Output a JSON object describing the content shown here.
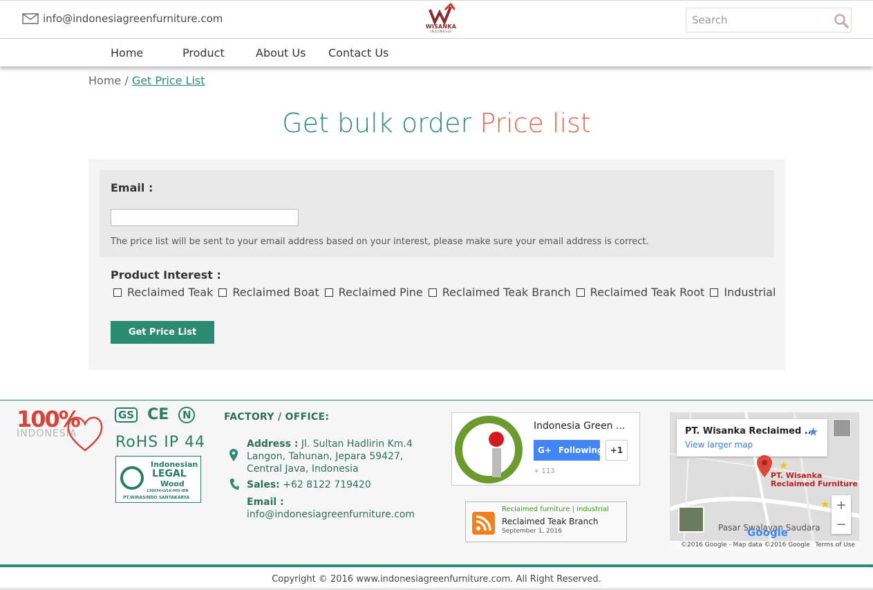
{
  "header": {
    "email": "info@indonesiagreenfurniture.com",
    "logo_text": "WISANKA",
    "logo_sub": "INDONESIA",
    "search_placeholder": "Search"
  },
  "nav": {
    "items": [
      {
        "label": "Home"
      },
      {
        "label": "Product"
      },
      {
        "label": "About Us"
      },
      {
        "label": "Contact Us"
      }
    ]
  },
  "breadcrumb": {
    "home": "Home",
    "separator": " / ",
    "current": "Get Price List"
  },
  "heading": {
    "part1": "Get bulk order ",
    "part2": "Price list"
  },
  "form": {
    "email_label": "Email :",
    "email_value": "",
    "hint": "The price list will be sent to your email address based on your interest, please make sure your email address is correct.",
    "interest_label": "Product Interest :",
    "interests": [
      {
        "label": "Reclaimed Teak",
        "checked": false
      },
      {
        "label": "Reclaimed Boat",
        "checked": false
      },
      {
        "label": "Reclaimed Pine",
        "checked": false
      },
      {
        "label": "Reclaimed Teak Branch",
        "checked": false
      },
      {
        "label": "Reclaimed Teak Root",
        "checked": false
      },
      {
        "label": "Industrial",
        "checked": false
      }
    ],
    "submit_label": "Get Price List"
  },
  "footer": {
    "badge_100": "100%",
    "badge_indonesia": "INDONESIA",
    "cert_gs": "GS",
    "cert_ce": "CE",
    "cert_n": "N",
    "rohs": "RoHS  IP 44",
    "legal": {
      "t1": "Indonesian",
      "t2": "LEGAL",
      "t3": "Wood",
      "t4": "130034-LVLK-005-IDN",
      "t5": "PT.WIRASINDO SANTAKARYA"
    },
    "factory_title": "FACTORY / OFFICE:",
    "address_label": "Address :",
    "address_lines": [
      "Jl. Sultan Hadlirin Km.4",
      "Langon, Tahunan, Jepara 59427,",
      "Central Java, Indonesia"
    ],
    "sales_label": "Sales:",
    "sales_value": "+62 8122 719420",
    "email_label": "Email :",
    "email_value": "info@indonesiagreenfurniture.com",
    "gplus": {
      "name": "Indonesia Green ...",
      "follow_label": "Following",
      "plusone": "+1",
      "count": "+ 113"
    },
    "rss": {
      "category": "Reclaimed furniture | industrial",
      "title": "Reclaimed Teak Branch",
      "date": "September 1, 2016"
    },
    "map": {
      "name": "PT. Wisanka Reclaimed ...",
      "link": "View larger map",
      "pin_label_1": "PT. Wisanka",
      "pin_label_2": "Reclaimed Furniture",
      "place": "Pasar Swalayan Saudara",
      "google": "Google",
      "credit": "©2016 Google - Map data ©2016 Google",
      "terms": "Terms of Use",
      "zoom_in": "+",
      "zoom_out": "−"
    }
  },
  "copyright": "Copyright © 2016 www.indonesiagreenfurniture.com. All Right Reserved.",
  "colors": {
    "green": "#2e8b73",
    "coral": "#e5664f",
    "google_blue": "#4285f4",
    "rss_orange": "#f57f1d"
  }
}
